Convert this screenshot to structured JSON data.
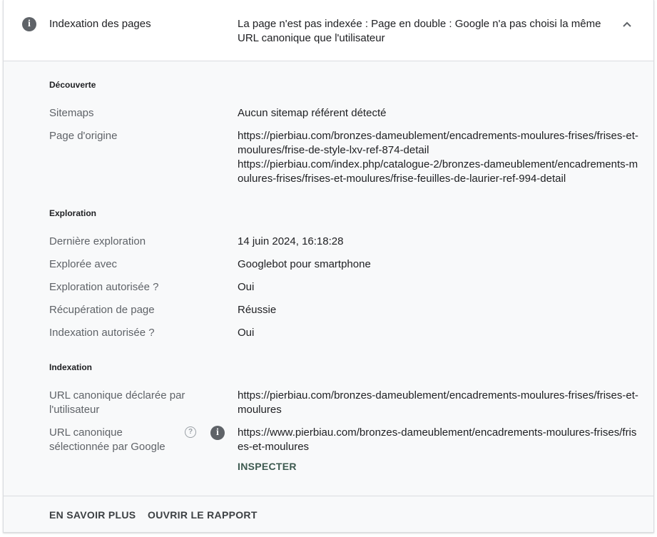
{
  "header": {
    "label": "Indexation des pages",
    "status": "La page n'est pas indexée : Page en double : Google n'a pas choisi la même URL canonique que l'utilisateur",
    "icons": {
      "info": "info-icon",
      "collapse": "chevron-up-icon"
    }
  },
  "discovery": {
    "title": "Découverte",
    "sitemaps_label": "Sitemaps",
    "sitemaps_value": "Aucun sitemap référent détecté",
    "origin_label": "Page d'origine",
    "origin_values": [
      "https://pierbiau.com/bronzes-dameublement/encadrements-moulures-frises/frises-et-moulures/frise-de-style-lxv-ref-874-detail",
      "https://pierbiau.com/index.php/catalogue-2/bronzes-dameublement/encadrements-moulures-frises/frises-et-moulures/frise-feuilles-de-laurier-ref-994-detail"
    ]
  },
  "crawl": {
    "title": "Exploration",
    "rows": [
      {
        "label": "Dernière exploration",
        "value": "14 juin 2024, 16:18:28"
      },
      {
        "label": "Explorée avec",
        "value": "Googlebot pour smartphone"
      },
      {
        "label": "Exploration autorisée ?",
        "value": "Oui"
      },
      {
        "label": "Récupération de page",
        "value": "Réussie"
      },
      {
        "label": "Indexation autorisée ?",
        "value": "Oui"
      }
    ]
  },
  "indexing": {
    "title": "Indexation",
    "declared_label": "URL canonique déclarée par l'utilisateur",
    "declared_value": "https://pierbiau.com/bronzes-dameublement/encadrements-moulures-frises/frises-et-moulures",
    "selected_label": "URL canonique sélectionnée par Google",
    "selected_value": "https://www.pierbiau.com/bronzes-dameublement/encadrements-moulures-frises/frises-et-moulures",
    "inspect_label": "INSPECTER",
    "icons": {
      "help": "help-circle-icon",
      "info": "info-icon"
    }
  },
  "footer": {
    "learn_more": "EN SAVOIR PLUS",
    "open_report": "OUVRIR LE RAPPORT"
  },
  "colors": {
    "label_gray": "#5f6368",
    "text_dark": "#202124",
    "panel_bg": "#f8f9fa",
    "divider": "#dadce0",
    "inspect_green": "#3d5a50"
  }
}
